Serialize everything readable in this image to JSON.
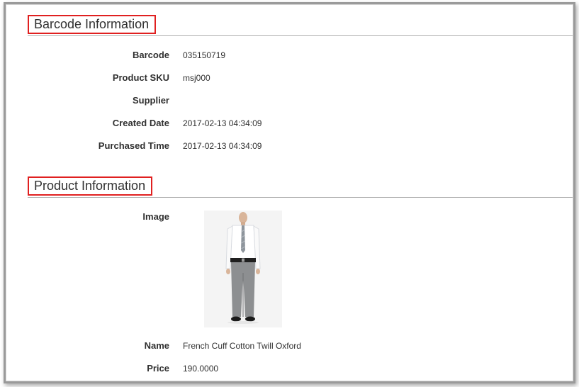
{
  "barcode_section": {
    "title": "Barcode Information",
    "fields": [
      {
        "label": "Barcode",
        "value": "035150719"
      },
      {
        "label": "Product SKU",
        "value": "msj000"
      },
      {
        "label": "Supplier",
        "value": ""
      },
      {
        "label": "Created Date",
        "value": "2017-02-13 04:34:09"
      },
      {
        "label": "Purchased Time",
        "value": "2017-02-13 04:34:09"
      }
    ]
  },
  "product_section": {
    "title": "Product Information",
    "image_label": "Image",
    "fields": [
      {
        "label": "Name",
        "value": "French Cuff Cotton Twill Oxford"
      },
      {
        "label": "Price",
        "value": "190.0000"
      }
    ]
  },
  "colors": {
    "highlight_border": "#e02020",
    "divider": "#adadad",
    "text": "#303030"
  }
}
